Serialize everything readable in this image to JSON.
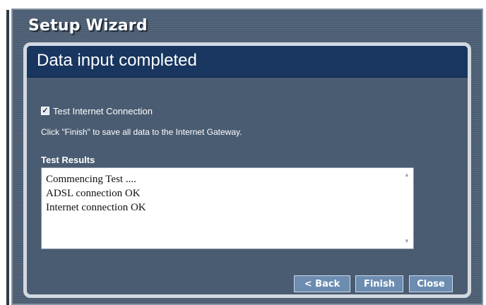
{
  "window": {
    "title": "Setup Wizard"
  },
  "panel": {
    "heading": "Data input completed",
    "test_checkbox": {
      "label": "Test Internet Connection",
      "checked": true
    },
    "instructions": "Click \"Finish\" to save all data to the Internet Gateway.",
    "results": {
      "label": "Test Results",
      "lines": [
        "Commencing Test ....",
        "ADSL connection OK",
        "Internet connection OK"
      ]
    }
  },
  "buttons": {
    "back": "< Back",
    "finish": "Finish",
    "close": "Close"
  },
  "icons": {
    "scroll_up": "scroll-up-arrow",
    "scroll_down": "scroll-down-arrow",
    "checkbox_mark": "check-mark"
  },
  "colors": {
    "frame_bg": "#4d5e73",
    "panel_bg": "#4a5c72",
    "header_bg": "#18365f",
    "button_bg": "#6c8cb0"
  }
}
